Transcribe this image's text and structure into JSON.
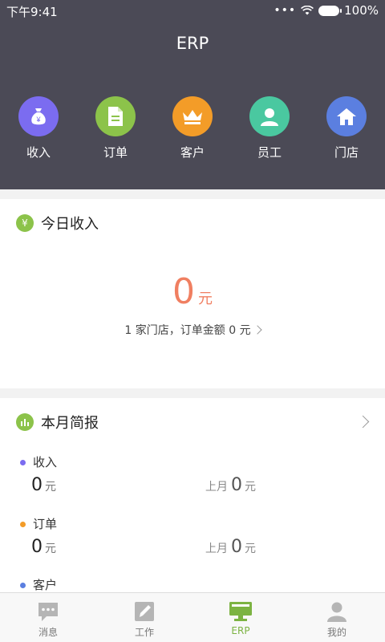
{
  "status": {
    "time": "下午9:41",
    "battery": "100%"
  },
  "header": {
    "title": "ERP"
  },
  "shortcuts": [
    {
      "label": "收入",
      "icon": "money-bag-icon",
      "color": "#7b6cf0"
    },
    {
      "label": "订单",
      "icon": "document-icon",
      "color": "#8cc34a"
    },
    {
      "label": "客户",
      "icon": "crown-icon",
      "color": "#f39c28"
    },
    {
      "label": "员工",
      "icon": "user-icon",
      "color": "#4ac8a0"
    },
    {
      "label": "门店",
      "icon": "home-icon",
      "color": "#5b7fe0"
    }
  ],
  "today_income": {
    "title": "今日收入",
    "icon_glyph": "¥",
    "amount": "0",
    "unit": "元",
    "summary": "1 家门店，订单金额 0 元"
  },
  "monthly_report": {
    "title": "本月简报",
    "metrics": [
      {
        "label": "收入",
        "dot_color": "#7b6cf0",
        "value": "0",
        "unit": "元",
        "prev_label": "上月",
        "prev_value": "0",
        "prev_unit": "元"
      },
      {
        "label": "订单",
        "dot_color": "#f39c28",
        "value": "0",
        "unit": "元",
        "prev_label": "上月",
        "prev_value": "0",
        "prev_unit": "元"
      },
      {
        "label": "客户",
        "dot_color": "#5b7fe0",
        "value": "",
        "unit": "",
        "prev_label": "",
        "prev_value": "",
        "prev_unit": ""
      }
    ]
  },
  "tabbar": {
    "tabs": [
      {
        "label": "消息",
        "icon": "chat-icon"
      },
      {
        "label": "工作",
        "icon": "edit-icon"
      },
      {
        "label": "ERP",
        "icon": "monitor-icon",
        "active": true
      },
      {
        "label": "我的",
        "icon": "person-icon"
      }
    ],
    "active_color": "#7cb342",
    "inactive_color": "#b5b5b5"
  }
}
